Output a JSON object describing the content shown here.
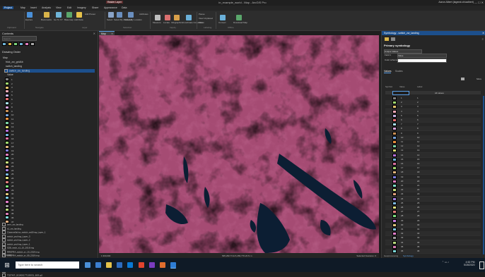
{
  "window": {
    "title": "in_example_world - Map - ArcGIS Pro",
    "user": "Aaron Albert (lagerat.ch/aalbert)"
  },
  "ribbon": {
    "tabs": [
      "Project",
      "Map",
      "Insert",
      "Analysis",
      "View",
      "Edit",
      "Imagery",
      "Share",
      "Appearance",
      "Data"
    ],
    "context_tab": "Raster Layer",
    "buttons": [
      "Explore",
      "Bookmarks",
      "Go To XY",
      "Basemap",
      "Add Data",
      "Add Preset",
      "Select",
      "Select By Attributes",
      "Select By Location",
      "Attributes",
      "Measure",
      "Locate",
      "Infographics",
      "Coordinate Conversion",
      "Pause",
      "View Unplaced",
      "More",
      "Convert",
      "Download Map"
    ],
    "groups": [
      "Clipboard",
      "Navigate",
      "Layer",
      "Selection",
      "Inquiry",
      "Labeling",
      "Offline"
    ]
  },
  "contents": {
    "title": "Contents",
    "search_placeholder": "Search",
    "drawing_order": "Drawing Order",
    "layers_top": [
      "Map",
      "frick_zw_gridAb",
      "switch_landing",
      "switch_zw_landing"
    ],
    "value_label": "Value",
    "legend": [
      {
        "v": "1",
        "c": "#7f7f7f"
      },
      {
        "v": "2",
        "c": "#9ed66e"
      },
      {
        "v": "3",
        "c": "#e3c26c"
      },
      {
        "v": "4",
        "c": "#f4a9b6"
      },
      {
        "v": "5",
        "c": "#c6b1e2"
      },
      {
        "v": "6",
        "c": "#e96e6e"
      },
      {
        "v": "7",
        "c": "#a5e0e8"
      },
      {
        "v": "8",
        "c": "#d7a1d9"
      },
      {
        "v": "9",
        "c": "#c98f54"
      },
      {
        "v": "10",
        "c": "#72a0d9"
      },
      {
        "v": "11",
        "c": "#ea8f3d"
      },
      {
        "v": "12",
        "c": "#7dd6a7"
      },
      {
        "v": "13",
        "c": "#d9d96f"
      },
      {
        "v": "14",
        "c": "#b56fd9"
      },
      {
        "v": "15",
        "c": "#6fb5d9"
      },
      {
        "v": "16",
        "c": "#d96f9e"
      },
      {
        "v": "17",
        "c": "#9ed96f"
      },
      {
        "v": "18",
        "c": "#e0b57d"
      },
      {
        "v": "19",
        "c": "#7d7de0"
      },
      {
        "v": "20",
        "c": "#e07dbd"
      },
      {
        "v": "21",
        "c": "#7de0c7"
      },
      {
        "v": "22",
        "c": "#c7e07d"
      },
      {
        "v": "23",
        "c": "#e0a07d"
      },
      {
        "v": "24",
        "c": "#a37de0"
      },
      {
        "v": "25",
        "c": "#7db9e0"
      },
      {
        "v": "26",
        "c": "#e0e07d"
      },
      {
        "v": "27",
        "c": "#e07d7d"
      },
      {
        "v": "28",
        "c": "#7de07d"
      },
      {
        "v": "29",
        "c": "#c87de0"
      },
      {
        "v": "30",
        "c": "#e0c87d"
      },
      {
        "v": "31",
        "c": "#7dc8e0"
      },
      {
        "v": "32",
        "c": "#e07dc8"
      },
      {
        "v": "33",
        "c": "#9c9c9c"
      },
      {
        "v": "34",
        "c": "#b5d97d"
      },
      {
        "v": "35",
        "c": "#d97db5"
      },
      {
        "v": "36",
        "c": "#7dd9d9"
      },
      {
        "v": "37",
        "c": "#d9a97d"
      }
    ],
    "layers_bottom": [
      "bern_zw_landing",
      "s1_zw_landing",
      "Ciaramella/mo_switch_zw5/img_Layer_1",
      "switch_pro/img_Layer_3",
      "switch_pro/img_Layer_2",
      "switch_pro/img_Layer_1",
      "S2B_swch_s1_10_2018.img",
      "RREFRA_switch_zr_19_2019.img",
      "RREFRA_switch_zr_09_2019.img",
      "switch_s1_10_17_2019.img",
      "T32TMT_20190517T103031_B8A.jp2",
      "T32TMT_20190517T103031_B08.jp2",
      "T32TMT_20190517T103031_B04.jp2",
      "T32TMT_20190517T103031_B03.jp2"
    ],
    "scale": "1:300,000"
  },
  "map": {
    "tab": "Map",
    "coords": "695,290.73 E 5,283,776.23 N m",
    "selected": "Selected Features: 0"
  },
  "symbology": {
    "title": "Symbology - switch_zw_landing",
    "heading": "Primary symbology",
    "renderer": "Unique Values",
    "field1_label": "Field 1",
    "field1_value": "Value",
    "scheme_label": "Color scheme",
    "tabs": [
      "Values",
      "Scales"
    ],
    "col_headers": [
      "Symbol",
      "Value",
      "Label"
    ],
    "all_values": "All values",
    "more_label": "More",
    "rows": [
      {
        "v": "1",
        "l": "1",
        "c": "#7f7f7f"
      },
      {
        "v": "2",
        "l": "2",
        "c": "#9ed66e"
      },
      {
        "v": "3",
        "l": "3",
        "c": "#e3c26c"
      },
      {
        "v": "4",
        "l": "4",
        "c": "#f4a9b6"
      },
      {
        "v": "5",
        "l": "5",
        "c": "#c6b1e2"
      },
      {
        "v": "6",
        "l": "6",
        "c": "#e96e6e"
      },
      {
        "v": "7",
        "l": "7",
        "c": "#a5e0e8"
      },
      {
        "v": "8",
        "l": "8",
        "c": "#d7a1d9"
      },
      {
        "v": "9",
        "l": "9",
        "c": "#c98f54"
      },
      {
        "v": "10",
        "l": "10",
        "c": "#72a0d9"
      },
      {
        "v": "11",
        "l": "11",
        "c": "#ea8f3d"
      },
      {
        "v": "12",
        "l": "12",
        "c": "#7dd6a7"
      },
      {
        "v": "13",
        "l": "13",
        "c": "#d9d96f"
      },
      {
        "v": "14",
        "l": "14",
        "c": "#b56fd9"
      },
      {
        "v": "15",
        "l": "15",
        "c": "#6fb5d9"
      },
      {
        "v": "16",
        "l": "16",
        "c": "#d96f9e"
      },
      {
        "v": "17",
        "l": "17",
        "c": "#9ed96f"
      },
      {
        "v": "18",
        "l": "18",
        "c": "#e0b57d"
      },
      {
        "v": "19",
        "l": "19",
        "c": "#7d7de0"
      },
      {
        "v": "20",
        "l": "20",
        "c": "#e07dbd"
      },
      {
        "v": "21",
        "l": "21",
        "c": "#7de0c7"
      },
      {
        "v": "22",
        "l": "22",
        "c": "#c7e07d"
      },
      {
        "v": "23",
        "l": "23",
        "c": "#e0a07d"
      },
      {
        "v": "24",
        "l": "24",
        "c": "#a37de0"
      },
      {
        "v": "25",
        "l": "25",
        "c": "#7db9e0"
      },
      {
        "v": "26",
        "l": "26",
        "c": "#e0e07d"
      },
      {
        "v": "27",
        "l": "27",
        "c": "#e07d7d"
      },
      {
        "v": "28",
        "l": "28",
        "c": "#7de07d"
      },
      {
        "v": "29",
        "l": "29",
        "c": "#c87de0"
      },
      {
        "v": "30",
        "l": "30",
        "c": "#e0c87d"
      },
      {
        "v": "31",
        "l": "31",
        "c": "#7dc8e0"
      },
      {
        "v": "32",
        "l": "32",
        "c": "#e07dc8"
      },
      {
        "v": "33",
        "l": "33",
        "c": "#9c9c9c"
      },
      {
        "v": "34",
        "l": "34",
        "c": "#b5d97d"
      },
      {
        "v": "35",
        "l": "35",
        "c": "#d97db5"
      },
      {
        "v": "36",
        "l": "36",
        "c": "#7dd9d9"
      }
    ],
    "bottom_tabs": [
      "Geoprocessing",
      "Symbology"
    ]
  },
  "taskbar": {
    "search_placeholder": "Type here to search",
    "time": "4:52 PM",
    "date": "5/28/2020"
  }
}
